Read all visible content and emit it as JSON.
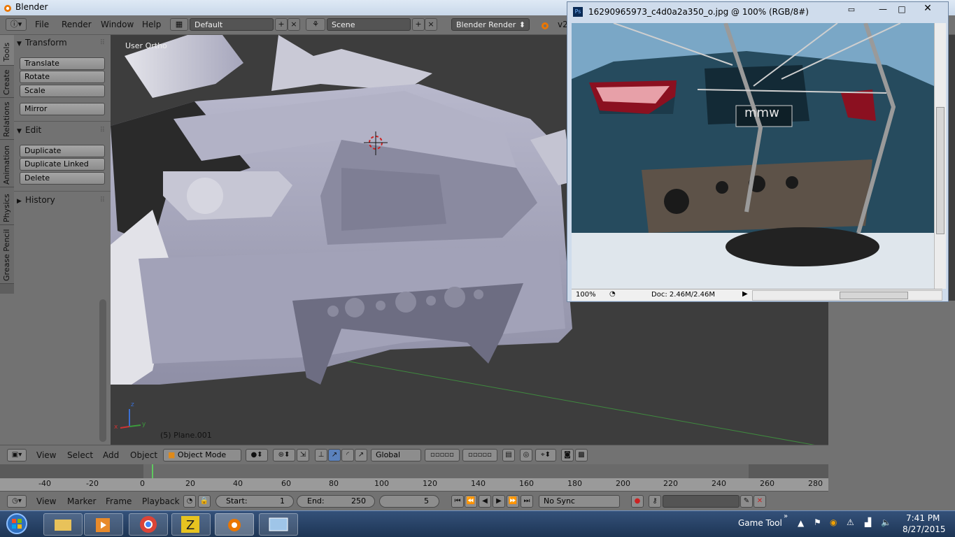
{
  "app": {
    "title": "Blender"
  },
  "header": {
    "menus": [
      "File",
      "Render",
      "Window",
      "Help"
    ],
    "layout": "Default",
    "scene": "Scene",
    "engine": "Blender Render",
    "version": "v2"
  },
  "tabs": [
    "Tools",
    "Create",
    "Relations",
    "Animation",
    "Physics",
    "Grease Pencil"
  ],
  "tool_panel": {
    "transform": {
      "title": "Transform",
      "buttons": [
        "Translate",
        "Rotate",
        "Scale"
      ],
      "mirror": "Mirror"
    },
    "edit": {
      "title": "Edit",
      "buttons": [
        "Duplicate",
        "Duplicate Linked",
        "Delete"
      ]
    },
    "history": {
      "title": "History"
    }
  },
  "viewport": {
    "view_label": "User Ortho",
    "object_label": "(5) Plane.001",
    "axes": {
      "x": "x",
      "y": "y",
      "z": "z"
    }
  },
  "view3d_header": {
    "menus": [
      "View",
      "Select",
      "Add",
      "Object"
    ],
    "mode": "Object Mode",
    "orientation": "Global"
  },
  "timeline": {
    "ticks": [
      "-40",
      "-20",
      "0",
      "20",
      "40",
      "60",
      "80",
      "100",
      "120",
      "140",
      "160",
      "180",
      "200",
      "220",
      "240",
      "260",
      "280"
    ],
    "current_frame": 5
  },
  "timeline_header": {
    "menus": [
      "View",
      "Marker",
      "Frame",
      "Playback"
    ],
    "start_label": "Start:",
    "start_value": "1",
    "end_label": "End:",
    "end_value": "250",
    "current": "5",
    "sync": "No Sync"
  },
  "photoshop": {
    "title": "16290965973_c4d0a2a350_o.jpg @ 100% (RGB/8#)",
    "zoom": "100%",
    "doc": "Doc: 2.46M/2.46M",
    "plate": "mmw"
  },
  "taskbar": {
    "game_tool": "Game Tool",
    "time": "7:41 PM",
    "date": "8/27/2015"
  },
  "colors": {
    "blender_bg": "#727272",
    "viewport_bg": "#3d3d3d",
    "mesh": "#a3a3b8",
    "taskbar": "#1d3554"
  }
}
